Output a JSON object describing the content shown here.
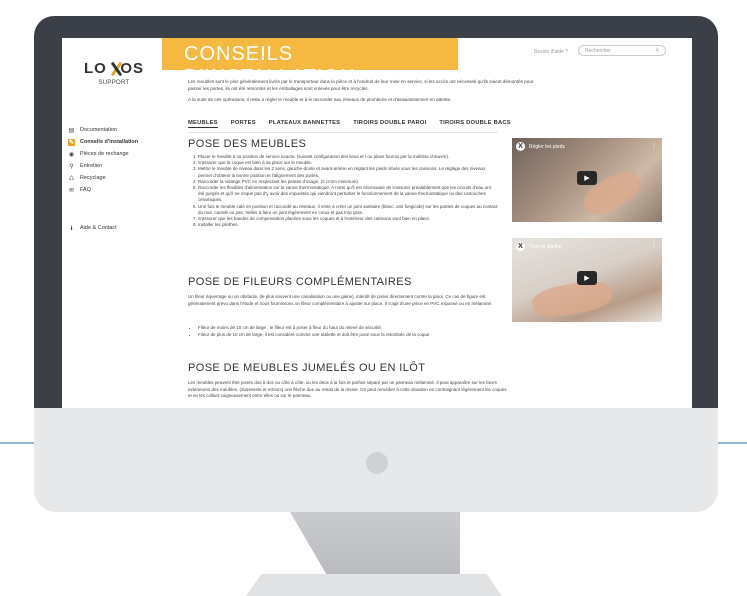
{
  "sidebar": {
    "logo": "LOXOS",
    "logo_sub": "SUPPORT",
    "items": [
      {
        "label": "Documentation",
        "icon": "document-icon",
        "glyph": "▤"
      },
      {
        "label": "Conseils d'installation",
        "icon": "wrench-icon",
        "glyph": "✎"
      },
      {
        "label": "Pièces de rechange",
        "icon": "parts-icon",
        "glyph": "◉"
      },
      {
        "label": "Entretien",
        "icon": "spray-icon",
        "glyph": "⚲"
      },
      {
        "label": "Recyclage",
        "icon": "recycle-icon",
        "glyph": "♺"
      },
      {
        "label": "FAQ",
        "icon": "chat-icon",
        "glyph": "✉"
      }
    ],
    "contact": {
      "label": "Aide & Contact",
      "icon": "info-icon",
      "glyph": "ℹ"
    }
  },
  "header": {
    "title": "CONSEILS D'INSTALLATION",
    "help_text": "Besoin d'aide ?",
    "search_placeholder": "Rechercher",
    "search_icon": "search-icon"
  },
  "intro": {
    "p1": "Les meubles sont le plus généralement livrés par le transporteur dans la pièce et à l'endroit de leur mise en service, si les accès ont nécessité qu'ils soient démontés pour passer les portes, ils ont été remontés et les emballages sont enlevés pour être recyclés.",
    "p2": "A la suite de ces opérations, il reste à régler le meuble et à le raccorder aux réseaux de plomberie et d'assainissement en attente."
  },
  "tabs": [
    "MEUBLES",
    "PORTES",
    "PLATEAUX BANNETTES",
    "TIROIRS DOUBLE PAROI",
    "TIROIRS DOUBLE BACS"
  ],
  "section1": {
    "title": "POSE DES MEUBLES",
    "steps": [
      "Placer le meuble à sa position de service exacte, (suivant configuration des lieux et / ou plans fournis par la maîtrise d'œuvre).",
      "S'assurer que la coque est bien à sa place sur le meuble.",
      "Mettre le meuble de niveau dans les 2 sens, gauche-droite et avant-arrière en réglant les pieds situés sous les caissons. Le réglage des niveaux permet d'obtenir la bonne position et l'alignement des portes.",
      "Raccorder la vidange PVC en respectant les pentes d'usage, (2 cm/m minimum).",
      "Raccorder les flexibles d'alimentation sur la vanne thermostatique. A noter qu'il est nécessaire de s'assurer préalablement que les circuits d'eau ont été purgés et qu'il ne risque pas d'y avoir des impuretés qui viendront perturber le fonctionnement de la vanne thermostatique ou des cartouches céramiques.",
      "Une fois le meuble calé en position et raccordé au réseaux, il reste à créer un joint sanitaire (blanc, anti fongicide) sur les parties de coques au contact du mur, carrelé ou pas. Veiller à faire un joint légèrement en creux et pas trop gras.",
      "S'assurer que les bandes de compensation placées sous les coques et à l'extérieur des caissons sont bien en place.",
      "Installer les plinthes."
    ]
  },
  "section2": {
    "title": "POSE DE FILEURS COMPLÉMENTAIRES",
    "para": "Un fileur équerrage ou un obstacle, (le plus souvent une canalisation ou une gaine), interdit de poser directement contre la paroi. Ce cas de figure est généralement prévu dans l'étude et nous fournissons un fileur complémentaire à ajuster sur place. Il s'agit d'une pièce en PVC expansé ou en mélaminé.",
    "bullets": [
      "Fileur de moins de 10 cm de large : le fileur est à poser à fleur du haut du relevé de sécurité,",
      "Fileur de plus de 10 cm de large, il est considéré comme une tablette et doit être posé sous la retombée de la coque"
    ]
  },
  "section3": {
    "title": "POSE DE MEUBLES JUMELÉS OU EN ILÔT",
    "para": "Les meubles peuvent être posés dos à dos ou côte à côte, ou les deux à la fois et parfois séparé par un panneau mélaminé. Il peut apparaître sur les faces extérieures des meubles, (dossierets et retours) une flèche due au retrait de la résine. On peut remédier à cette situation en contraignant légèrement les coques et en les collant soigneusement entre elles ou sur le panneau."
  },
  "videos": [
    {
      "title": "Régler les pieds",
      "play_icon": "play-icon"
    },
    {
      "title": "Fixer la plinthe",
      "play_icon": "play-icon"
    }
  ],
  "colors": {
    "accent": "#f5b841",
    "frame": "#3b3f47",
    "floor": "#8fb6d6"
  }
}
